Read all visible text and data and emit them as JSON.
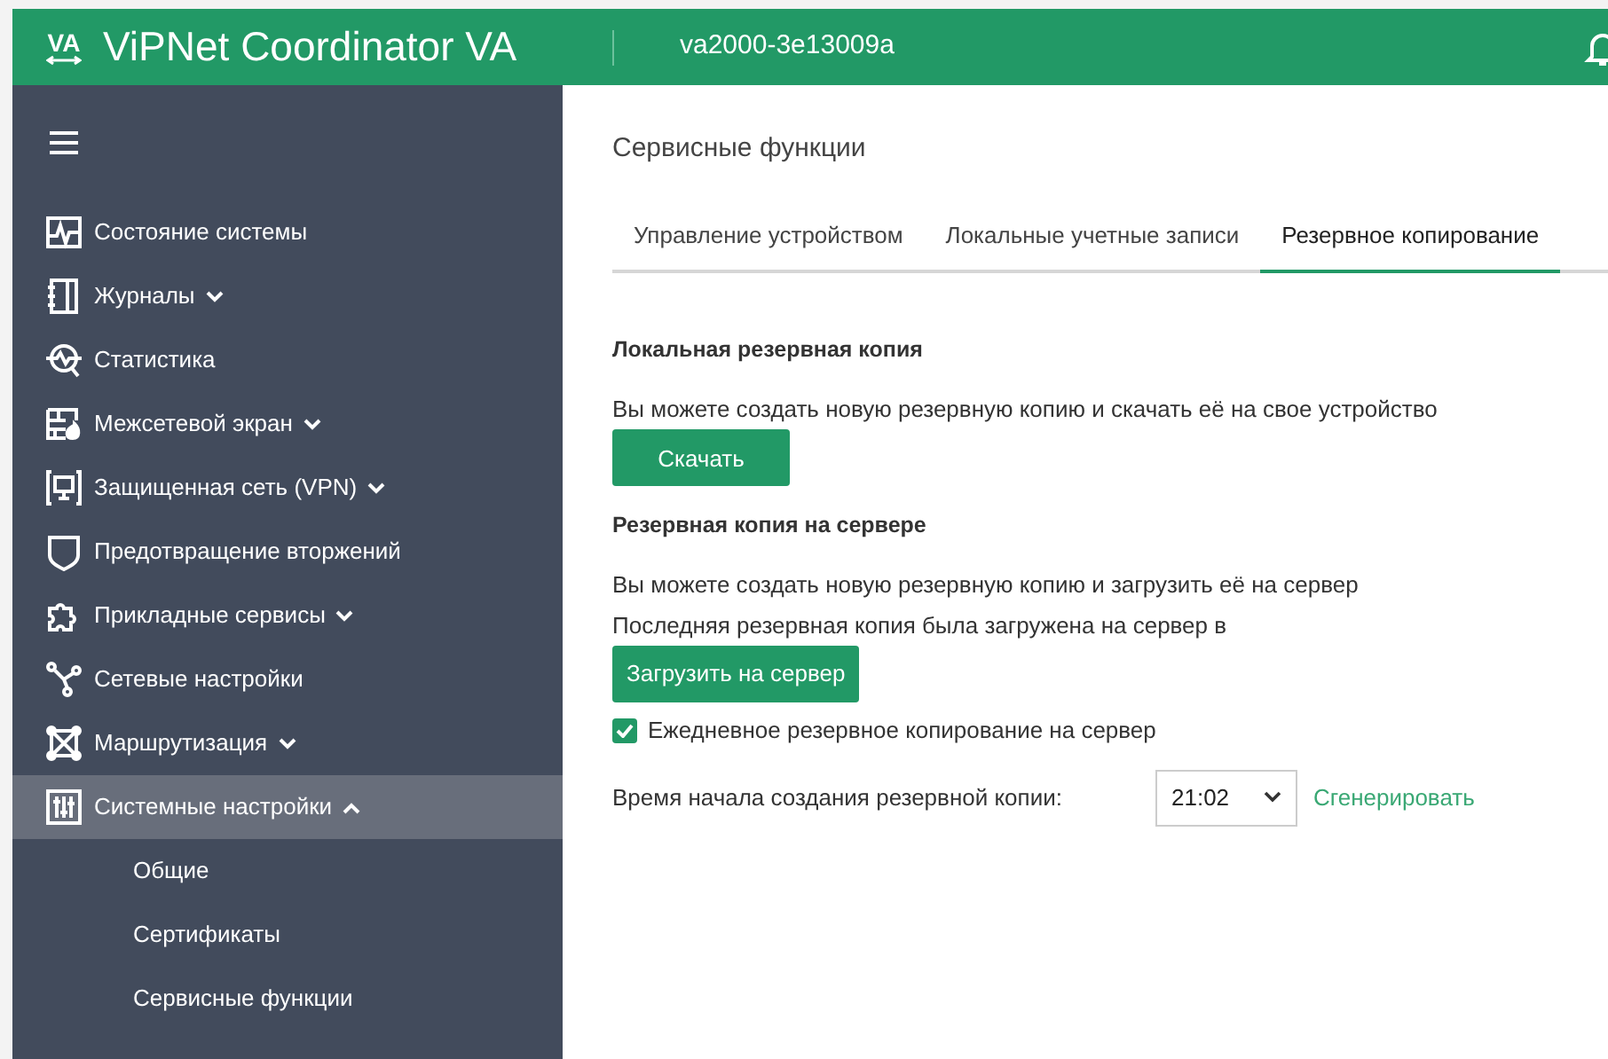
{
  "header": {
    "product_light": "ViPNet",
    "product_bold": "Coordinator VA",
    "logo": "VA",
    "device": "va2000-3e13009a"
  },
  "sidebar": {
    "items": [
      {
        "label": "Состояние системы",
        "kind": "link",
        "selected": false
      },
      {
        "label": "Журналы",
        "kind": "collapsed",
        "selected": false
      },
      {
        "label": "Статистика",
        "kind": "link",
        "selected": false
      },
      {
        "label": "Межсетевой экран",
        "kind": "collapsed",
        "selected": false
      },
      {
        "label": "Защищенная сеть (VPN)",
        "kind": "collapsed",
        "selected": false
      },
      {
        "label": "Предотвращение вторжений",
        "kind": "link",
        "selected": false
      },
      {
        "label": "Прикладные сервисы",
        "kind": "collapsed",
        "selected": false
      },
      {
        "label": "Сетевые настройки",
        "kind": "link",
        "selected": false
      },
      {
        "label": "Маршрутизация",
        "kind": "collapsed",
        "selected": false
      },
      {
        "label": "Системные настройки",
        "kind": "expanded",
        "selected": true,
        "children": [
          {
            "label": "Общие"
          },
          {
            "label": "Сертификаты"
          },
          {
            "label": "Сервисные функции"
          }
        ]
      }
    ]
  },
  "page": {
    "title": "Сервисные функции",
    "tabs": [
      {
        "label": "Управление устройством",
        "selected": false
      },
      {
        "label": "Локальные учетные записи",
        "selected": false
      },
      {
        "label": "Резервное копирование",
        "selected": true
      }
    ],
    "local": {
      "heading": "Локальная резервная копия",
      "text": "Вы можете создать новую резервную копию и скачать её на свое устройство",
      "button": "Скачать"
    },
    "server": {
      "heading": "Резервная копия на сервере",
      "lines": [
        "Вы можете создать новую резервную копию и загрузить её на сервер",
        "Последняя резервная копия была загружена на сервер в"
      ],
      "button": "Загрузить на сервер",
      "daily": {
        "label": "Ежедневное резервное копирование на сервер",
        "checked": true
      },
      "time_label": "Время начала создания резервной копии:",
      "time_value": "21:02",
      "generate": "Сгенерировать"
    }
  }
}
